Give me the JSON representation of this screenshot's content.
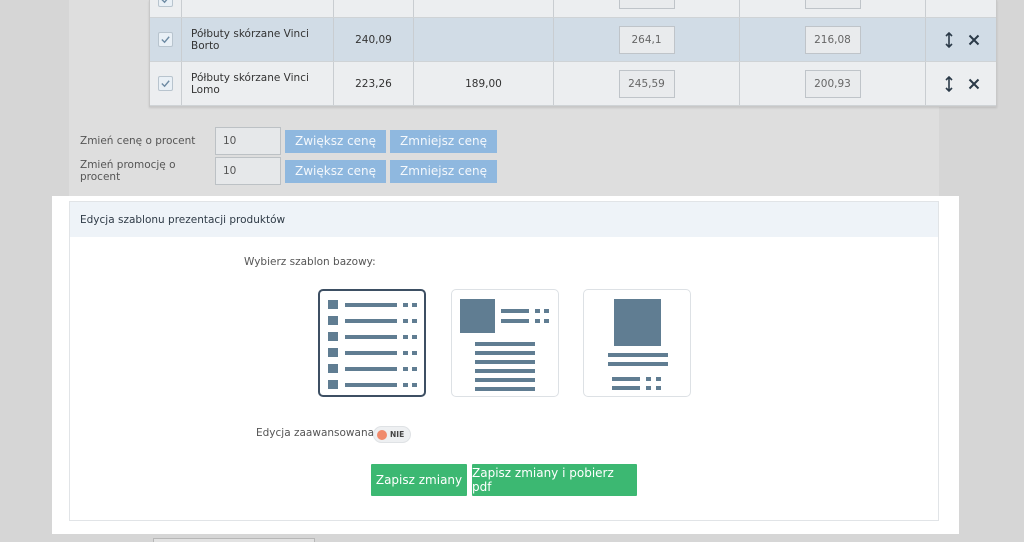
{
  "table": {
    "rows": [
      {
        "name": "",
        "price": "",
        "promo": "",
        "new_price": "",
        "new_promo": "",
        "checked": true
      },
      {
        "name": "Półbuty skórzane Vinci Borto",
        "price": "240,09",
        "promo": "",
        "new_price": "264,1",
        "new_promo": "216,08",
        "checked": true
      },
      {
        "name": "Półbuty skórzane Vinci Lomo",
        "price": "223,26",
        "promo": "189,00",
        "new_price": "245,59",
        "new_promo": "200,93",
        "checked": true
      }
    ],
    "icons": {
      "checkbox": "checkmark-icon",
      "move": "vertical-arrows-icon",
      "delete": "close-x-icon"
    }
  },
  "price_adjust": {
    "price_label": "Zmień cenę o procent",
    "price_value": "10",
    "promo_label": "Zmień promocję o procent",
    "promo_value": "10",
    "increase_label": "Zwiększ cenę",
    "decrease_label": "Zmniejsz cenę"
  },
  "template_editor": {
    "title": "Edycja szablonu prezentacji produktów",
    "choose_label": "Wybierz szablon bazowy:",
    "selected_template": 1,
    "advanced_label": "Edycja zaawansowana:",
    "advanced_state": "NIE",
    "save_label": "Zapisz zmiany",
    "save_pdf_label": "Zapisz zmiany i pobierz pdf"
  },
  "colors": {
    "accent_green": "#3cb872",
    "button_blue": "#8fb8df",
    "template_icon": "#607d92",
    "selected_border": "#3d4f63",
    "toggle_off": "#f08a6c",
    "row_highlight": "#d1dce6"
  }
}
